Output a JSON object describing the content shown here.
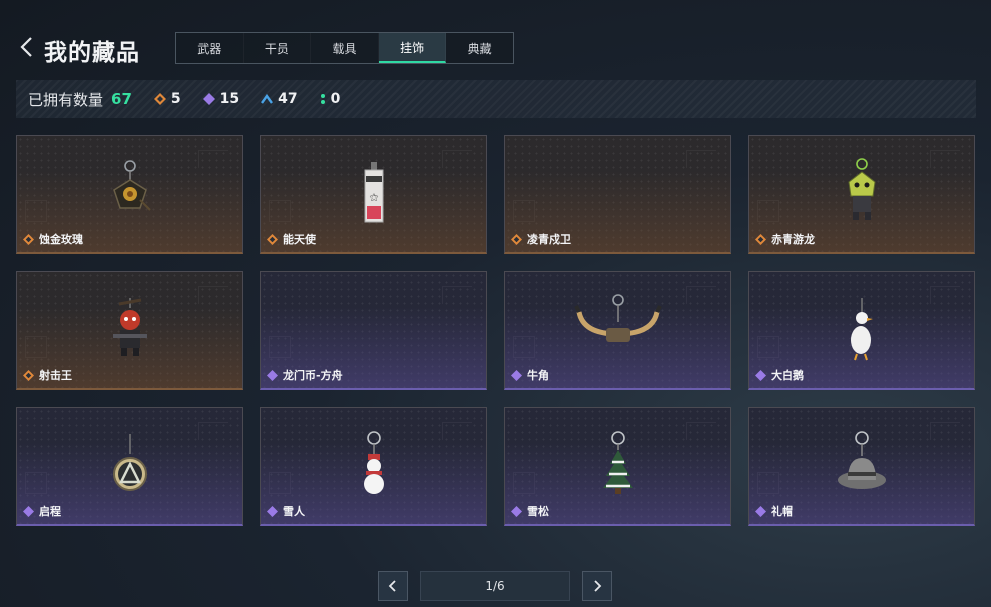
{
  "header": {
    "title": "我的藏品",
    "tabs": [
      {
        "label": "武器",
        "active": false
      },
      {
        "label": "干员",
        "active": false
      },
      {
        "label": "载具",
        "active": false
      },
      {
        "label": "挂饰",
        "active": true
      },
      {
        "label": "典藏",
        "active": false
      }
    ]
  },
  "stats": {
    "owned_label": "已拥有数量",
    "owned_total": "67",
    "counts": [
      {
        "icon": "orange-rarity-icon",
        "value": "5"
      },
      {
        "icon": "purple-rarity-icon",
        "value": "15"
      },
      {
        "icon": "blue-rarity-icon",
        "value": "47"
      },
      {
        "icon": "green-rarity-icon",
        "value": "0"
      }
    ]
  },
  "items": [
    {
      "name": "蚀金玫瑰",
      "rarity": "gold",
      "icon": "rose-charm-icon"
    },
    {
      "name": "能天使",
      "rarity": "gold",
      "icon": "exusiai-charm-icon"
    },
    {
      "name": "凌青戍卫",
      "rarity": "gold",
      "icon": ""
    },
    {
      "name": "赤青游龙",
      "rarity": "gold",
      "icon": "dragon-charm-icon"
    },
    {
      "name": "射击王",
      "rarity": "gold",
      "icon": "shooter-king-charm-icon"
    },
    {
      "name": "龙门币-方舟",
      "rarity": "purple",
      "icon": ""
    },
    {
      "name": "牛角",
      "rarity": "purple",
      "icon": "horn-charm-icon"
    },
    {
      "name": "大白鹅",
      "rarity": "purple",
      "icon": "goose-charm-icon"
    },
    {
      "name": "启程",
      "rarity": "purple",
      "icon": "triangle-charm-icon"
    },
    {
      "name": "雪人",
      "rarity": "purple",
      "icon": "snowman-charm-icon"
    },
    {
      "name": "雪松",
      "rarity": "purple",
      "icon": "pine-tree-charm-icon"
    },
    {
      "name": "礼帽",
      "rarity": "purple",
      "icon": "top-hat-charm-icon"
    }
  ],
  "pagination": {
    "display": "1/6"
  },
  "colors": {
    "accent": "#2fd9a3",
    "gold": "#e0883a",
    "purple": "#9a7be6",
    "blue": "#4aa3e6",
    "green": "#36e0a0"
  }
}
